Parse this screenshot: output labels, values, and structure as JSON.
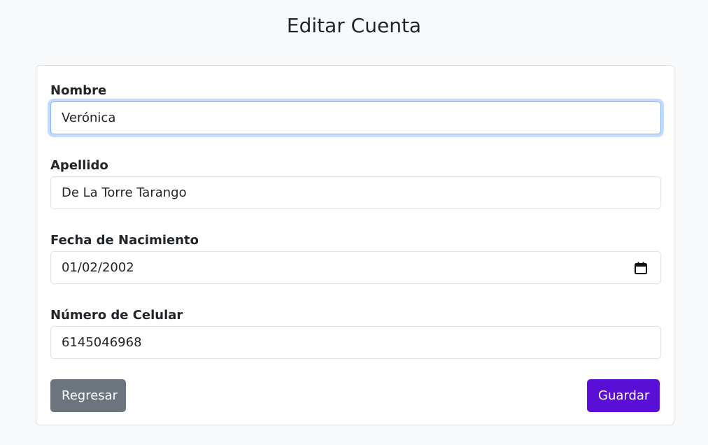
{
  "page": {
    "title": "Editar Cuenta"
  },
  "form": {
    "nombre": {
      "label": "Nombre",
      "value": "Verónica"
    },
    "apellido": {
      "label": "Apellido",
      "value": "De La Torre Tarango"
    },
    "fecha_nacimiento": {
      "label": "Fecha de Nacimiento",
      "value": "01/02/2002"
    },
    "celular": {
      "label": "Número de Celular",
      "value": "6145046968"
    }
  },
  "actions": {
    "back_label": "Regresar",
    "save_label": "Guardar"
  },
  "icons": {
    "date_picker": "calendar-icon"
  },
  "colors": {
    "save_button": "#5a0fd6",
    "back_button": "#6c757d",
    "focus_ring": "#86b7fe"
  }
}
